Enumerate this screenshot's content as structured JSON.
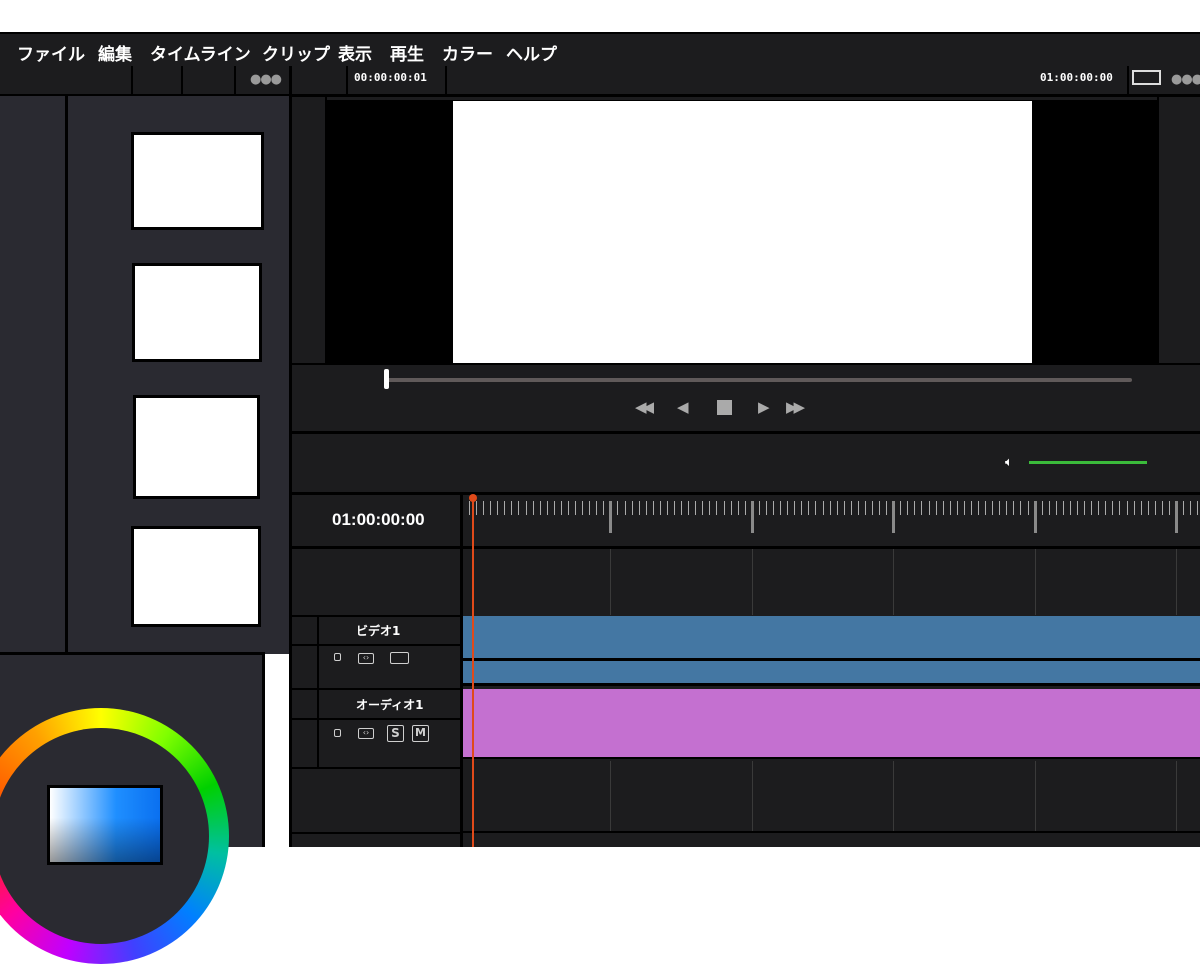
{
  "menu": {
    "items": [
      "ファイル",
      "編集",
      "タイムライン",
      "クリップ",
      "表示",
      "再生",
      "カラー",
      "ヘルプ"
    ]
  },
  "viewer": {
    "source_timecode": "00:00:00:01",
    "record_timecode": "01:00:00:00"
  },
  "timeline": {
    "timecode": "01:00:00:00",
    "tracks": [
      {
        "name": "ビデオ1",
        "color": "#4477a3"
      },
      {
        "name": "オーディオ1",
        "color": "#c470d0"
      }
    ],
    "solo_label": "S",
    "mute_label": "M"
  },
  "colors": {
    "volume_level": "#3bbb3b",
    "playhead": "#e04a1a"
  },
  "icons": [
    "more-dots-icon",
    "aspect-frame-icon",
    "rewind-icon",
    "step-back-icon",
    "stop-icon",
    "play-icon",
    "fast-forward-icon",
    "speaker-icon",
    "lock-icon",
    "sync-icon",
    "film-icon"
  ]
}
